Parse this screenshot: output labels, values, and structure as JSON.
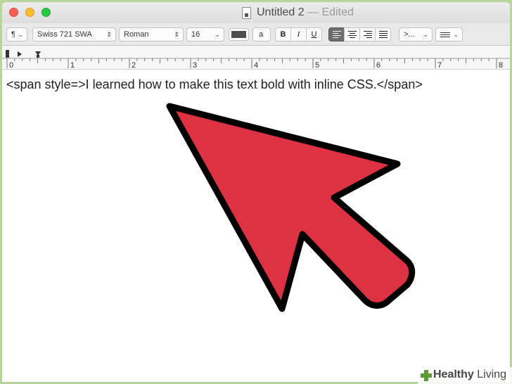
{
  "window": {
    "title": "Untitled 2",
    "title_separator": "—",
    "status": "Edited"
  },
  "toolbar": {
    "paragraph_style": "¶",
    "font_family": "Swiss 721 SWA",
    "typeface": "Roman",
    "font_size": "16",
    "text_color": "#4d4d4d",
    "background_color_label": "a",
    "bold_label": "B",
    "italic_label": "I",
    "underline_label": "U",
    "alignment_selected": "left",
    "spacing_label": ">...",
    "list_icon": "list-icon"
  },
  "ruler": {
    "numbers": [
      "0",
      "1",
      "2",
      "3",
      "4",
      "5",
      "6",
      "7",
      "8"
    ]
  },
  "document": {
    "text": "<span style=>I learned how to make this text bold with inline CSS.</span>"
  },
  "overlay": {
    "arrow_color": "#de3142",
    "arrow_outline": "#000000"
  },
  "watermark": {
    "bold": "Healthy",
    "light": " Living"
  }
}
